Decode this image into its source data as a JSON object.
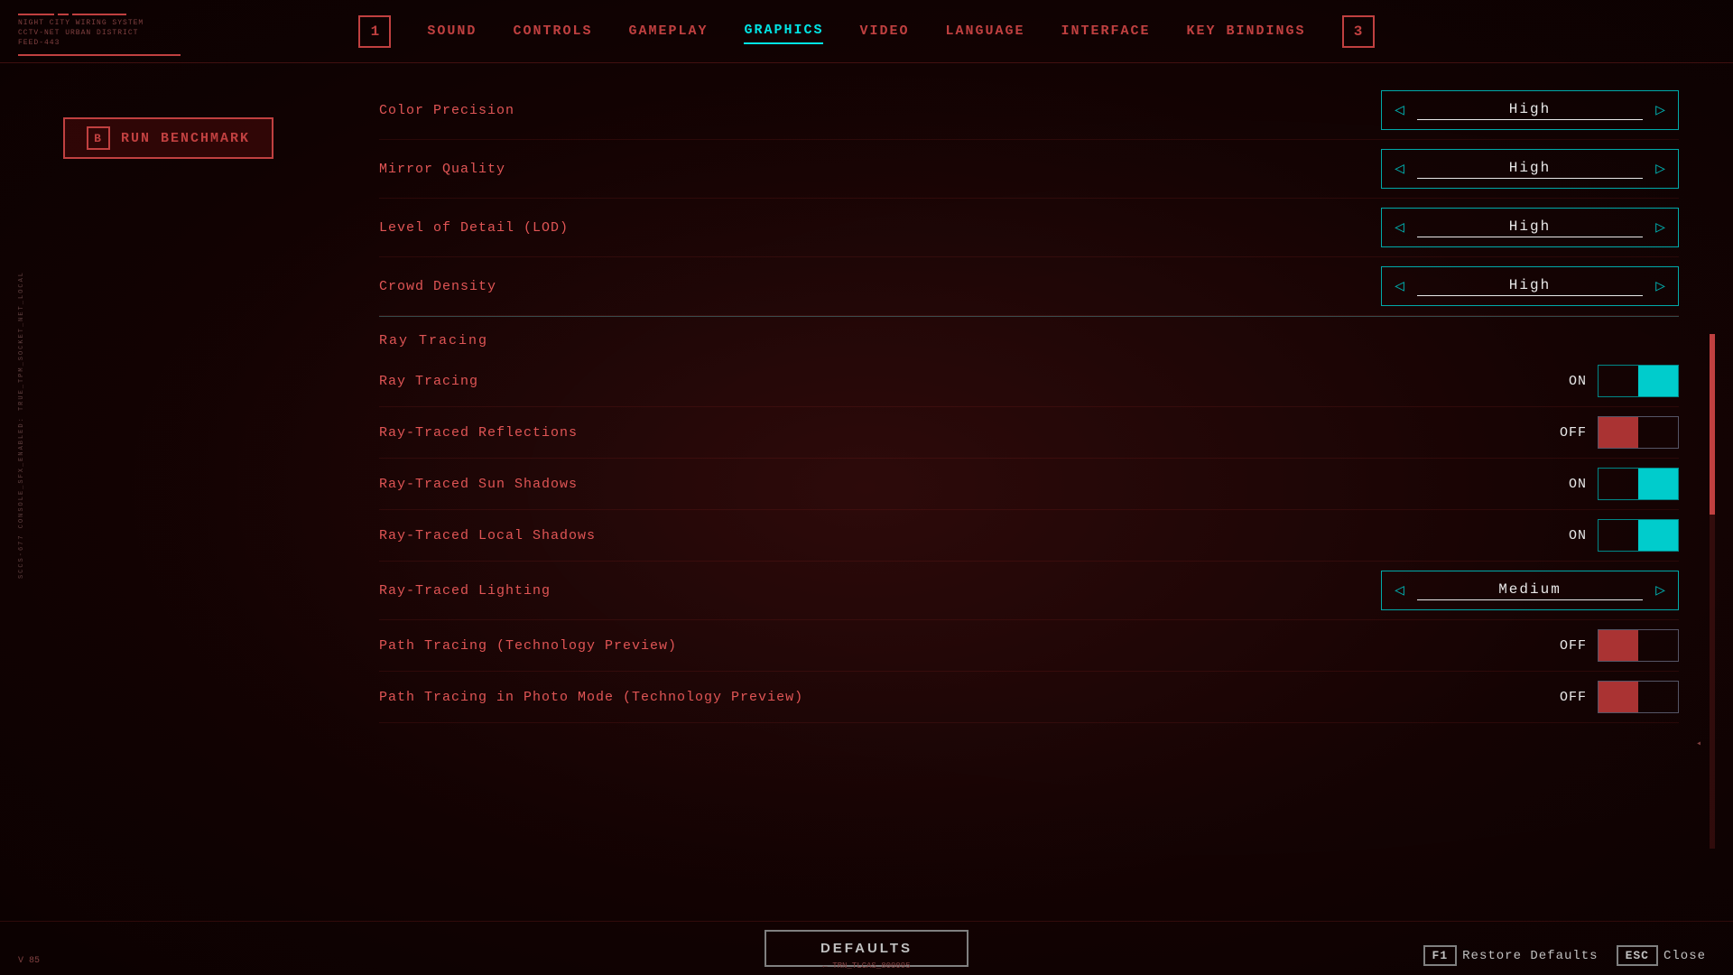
{
  "nav": {
    "badge_left": "1",
    "badge_right": "3",
    "items": [
      {
        "label": "SOUND",
        "active": false
      },
      {
        "label": "CONTROLS",
        "active": false
      },
      {
        "label": "GAMEPLAY",
        "active": false
      },
      {
        "label": "GRAPHICS",
        "active": true
      },
      {
        "label": "VIDEO",
        "active": false
      },
      {
        "label": "LANGUAGE",
        "active": false
      },
      {
        "label": "INTERFACE",
        "active": false
      },
      {
        "label": "KEY BINDINGS",
        "active": false
      }
    ]
  },
  "sidebar": {
    "benchmark_badge": "B",
    "benchmark_label": "RUN BENCHMARK"
  },
  "settings": {
    "selectors": [
      {
        "label": "Color Precision",
        "value": "High"
      },
      {
        "label": "Mirror Quality",
        "value": "High"
      },
      {
        "label": "Level of Detail (LOD)",
        "value": "High"
      },
      {
        "label": "Crowd Density",
        "value": "High"
      }
    ],
    "ray_tracing_section": "Ray Tracing",
    "toggles": [
      {
        "label": "Ray Tracing",
        "state": "ON",
        "on": true
      },
      {
        "label": "Ray-Traced Reflections",
        "state": "OFF",
        "on": false
      },
      {
        "label": "Ray-Traced Sun Shadows",
        "state": "ON",
        "on": true
      },
      {
        "label": "Ray-Traced Local Shadows",
        "state": "ON",
        "on": true
      }
    ],
    "ray_traced_lighting": {
      "label": "Ray-Traced Lighting",
      "value": "Medium"
    },
    "path_toggles": [
      {
        "label": "Path Tracing (Technology Preview)",
        "state": "OFF",
        "on": false
      },
      {
        "label": "Path Tracing in Photo Mode (Technology Preview)",
        "state": "OFF",
        "on": false
      }
    ]
  },
  "bottom": {
    "defaults_label": "DEFAULTS",
    "restore_badge": "F1",
    "restore_label": "Restore Defaults",
    "close_badge": "ESC",
    "close_label": "Close"
  },
  "deco": {
    "version": "V\n85",
    "bottom_code": "← TRN_TLCAS_800095",
    "left_text": "SCCS-677 CONSOLE_SFX_ENABLED: TRUE_TPM_SOCKET_NET_LOCAL",
    "right_marker": "◂"
  }
}
